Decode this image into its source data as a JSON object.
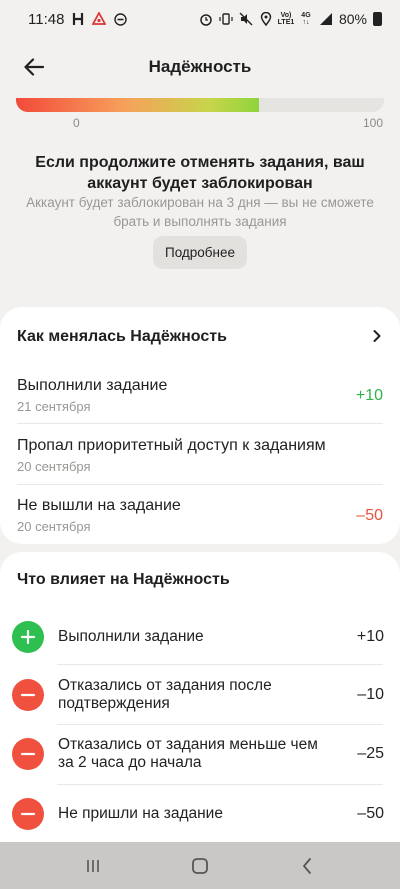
{
  "status": {
    "time": "11:48",
    "battery": "80%"
  },
  "header": {
    "title": "Надёжность"
  },
  "reliability": {
    "level": 0.66,
    "scale_min": "0",
    "scale_max": "100"
  },
  "warning": {
    "title": "Если продолжите отменять задания, ваш аккаунт будет заблокирован",
    "subtitle": "Аккаунт будет заблокирован на 3 дня — вы не сможете брать и выполнять задания",
    "more_label": "Подробнее"
  },
  "history": {
    "title": "Как менялась Надёжность",
    "items": [
      {
        "title": "Выполнили задание",
        "date": "21 сентября",
        "value": "+10"
      },
      {
        "title": "Пропал приоритетный доступ к заданиям",
        "date": "20 сентября",
        "value": ""
      },
      {
        "title": "Не вышли на задание",
        "date": "20 сентября",
        "value": "–50"
      }
    ]
  },
  "factors": {
    "title": "Что влияет на Надёжность",
    "items": [
      {
        "icon": "plus-icon",
        "text": "Выполнили задание",
        "value": "+10"
      },
      {
        "icon": "minus-icon",
        "text": "Отказались от задания после подтверждения",
        "value": "–10"
      },
      {
        "icon": "minus-icon",
        "text": "Отказались от задания меньше чем за 2 часа до начала",
        "value": "–25"
      },
      {
        "icon": "minus-icon",
        "text": "Не пришли на задание",
        "value": "–50"
      }
    ]
  },
  "colors": {
    "positive": "#2fb44b",
    "negative": "#e8533f",
    "plus_icon_bg": "#2dbf4f",
    "minus_icon_bg": "#f0513f"
  }
}
